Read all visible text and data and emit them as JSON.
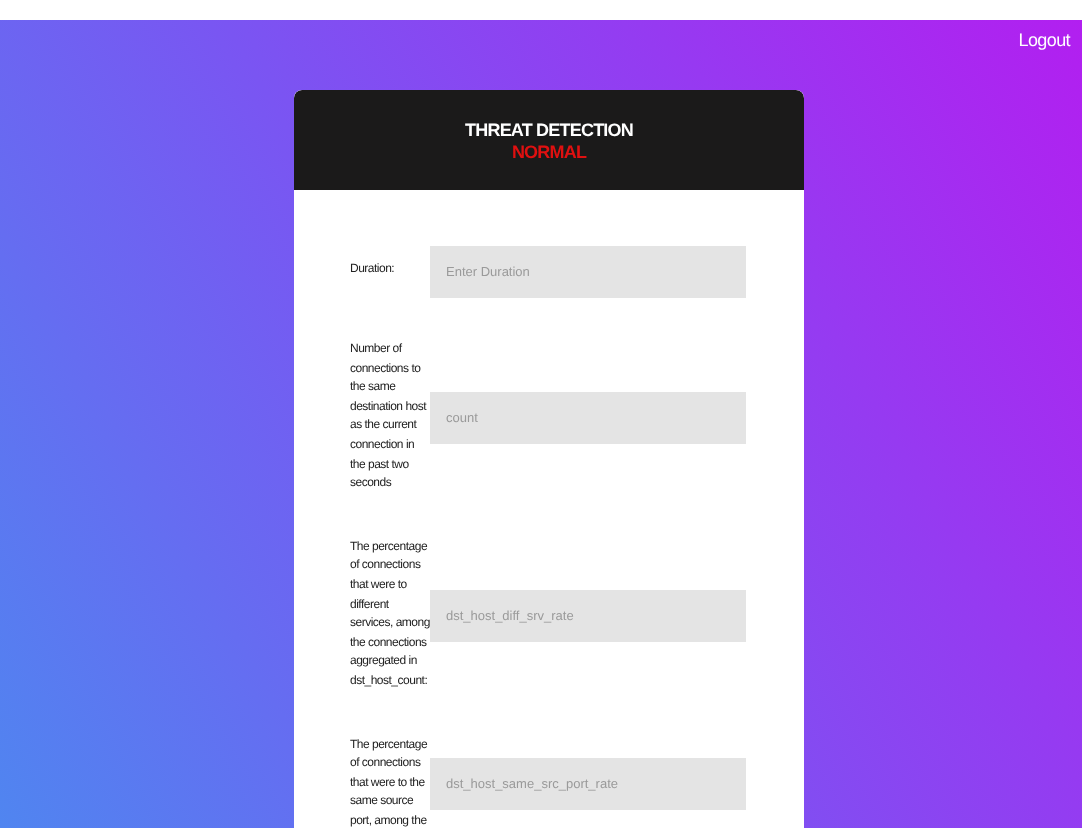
{
  "nav": {
    "logout": "Logout"
  },
  "card": {
    "title": "THREAT DETECTION",
    "status": "NORMAL"
  },
  "fields": [
    {
      "label": "Duration:",
      "placeholder": "Enter Duration"
    },
    {
      "label": "Number of connections to the same destination host as the current connection in the past two seconds",
      "placeholder": "count"
    },
    {
      "label": "The percentage of connections that were to different services, among the connections aggregated in dst_host_count:",
      "placeholder": "dst_host_diff_srv_rate"
    },
    {
      "label": "The percentage of connections that were to the same source port, among the",
      "placeholder": "dst_host_same_src_port_rate"
    }
  ]
}
